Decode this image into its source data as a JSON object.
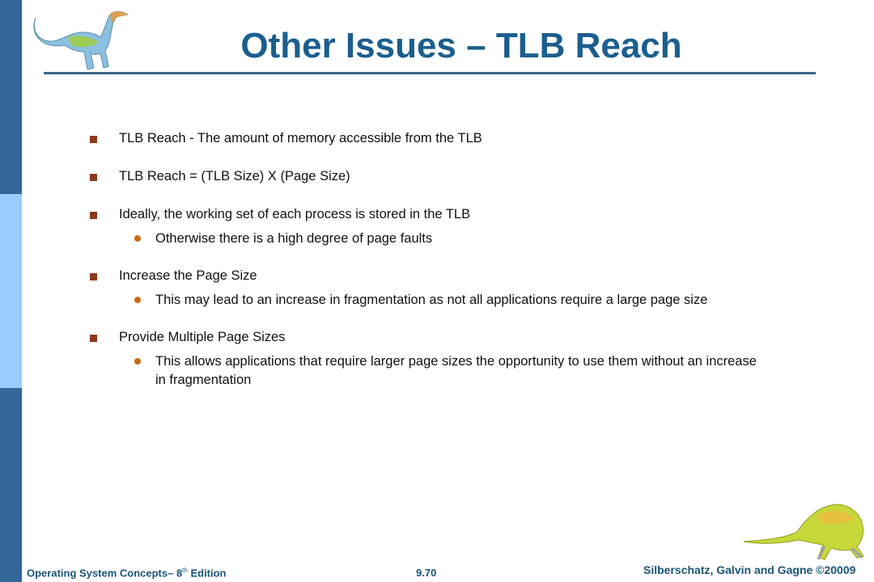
{
  "slide": {
    "title": "Other Issues – TLB Reach",
    "bullets": [
      {
        "text": "TLB Reach - The amount of memory accessible from the TLB",
        "sub": []
      },
      {
        "text": "TLB Reach = (TLB Size) X (Page Size)",
        "sub": []
      },
      {
        "text": "Ideally, the working set of each process is stored in the TLB",
        "sub": [
          "Otherwise there is a high degree of page faults"
        ]
      },
      {
        "text": "Increase the Page Size",
        "sub": [
          "This may lead to an increase in fragmentation as not all applications require a large page size"
        ]
      },
      {
        "text": "Provide Multiple Page Sizes",
        "sub": [
          "This allows applications that require larger page sizes the opportunity to use them without an increase in fragmentation"
        ]
      }
    ]
  },
  "footer": {
    "book": "Operating System Concepts– 8",
    "book_sup": "th",
    "book_suffix": " Edition",
    "page": "9.70",
    "copyright": "Silberschatz, Galvin and Gagne ©20009"
  },
  "colors": {
    "title": "#1a5e8f",
    "sidebar_dark": "#336699",
    "sidebar_light": "#99ccff",
    "bullet_square": "#8b3a1a",
    "bullet_dot": "#cc6a14"
  }
}
